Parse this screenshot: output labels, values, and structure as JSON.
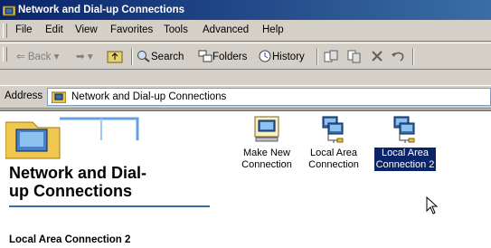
{
  "window": {
    "title": "Network and Dial-up Connections"
  },
  "menu": [
    "File",
    "Edit",
    "View",
    "Favorites",
    "Tools",
    "Advanced",
    "Help"
  ],
  "toolbar": {
    "back": "Back",
    "search": "Search",
    "folders": "Folders",
    "history": "History"
  },
  "address": {
    "label": "Address",
    "value": "Network and Dial-up Connections"
  },
  "panel": {
    "title_line1": "Network and Dial-",
    "title_line2": "up Connections",
    "selected_heading": "Local Area Connection 2"
  },
  "icons": [
    {
      "line1": "Make New",
      "line2": "Connection"
    },
    {
      "line1": "Local Area",
      "line2": "Connection"
    },
    {
      "line1": "Local Area",
      "line2": "Connection 2",
      "selected": true
    }
  ],
  "colors": {
    "selection": "#0a246a",
    "title_start": "#0a246a",
    "title_end": "#3a6ea5"
  }
}
